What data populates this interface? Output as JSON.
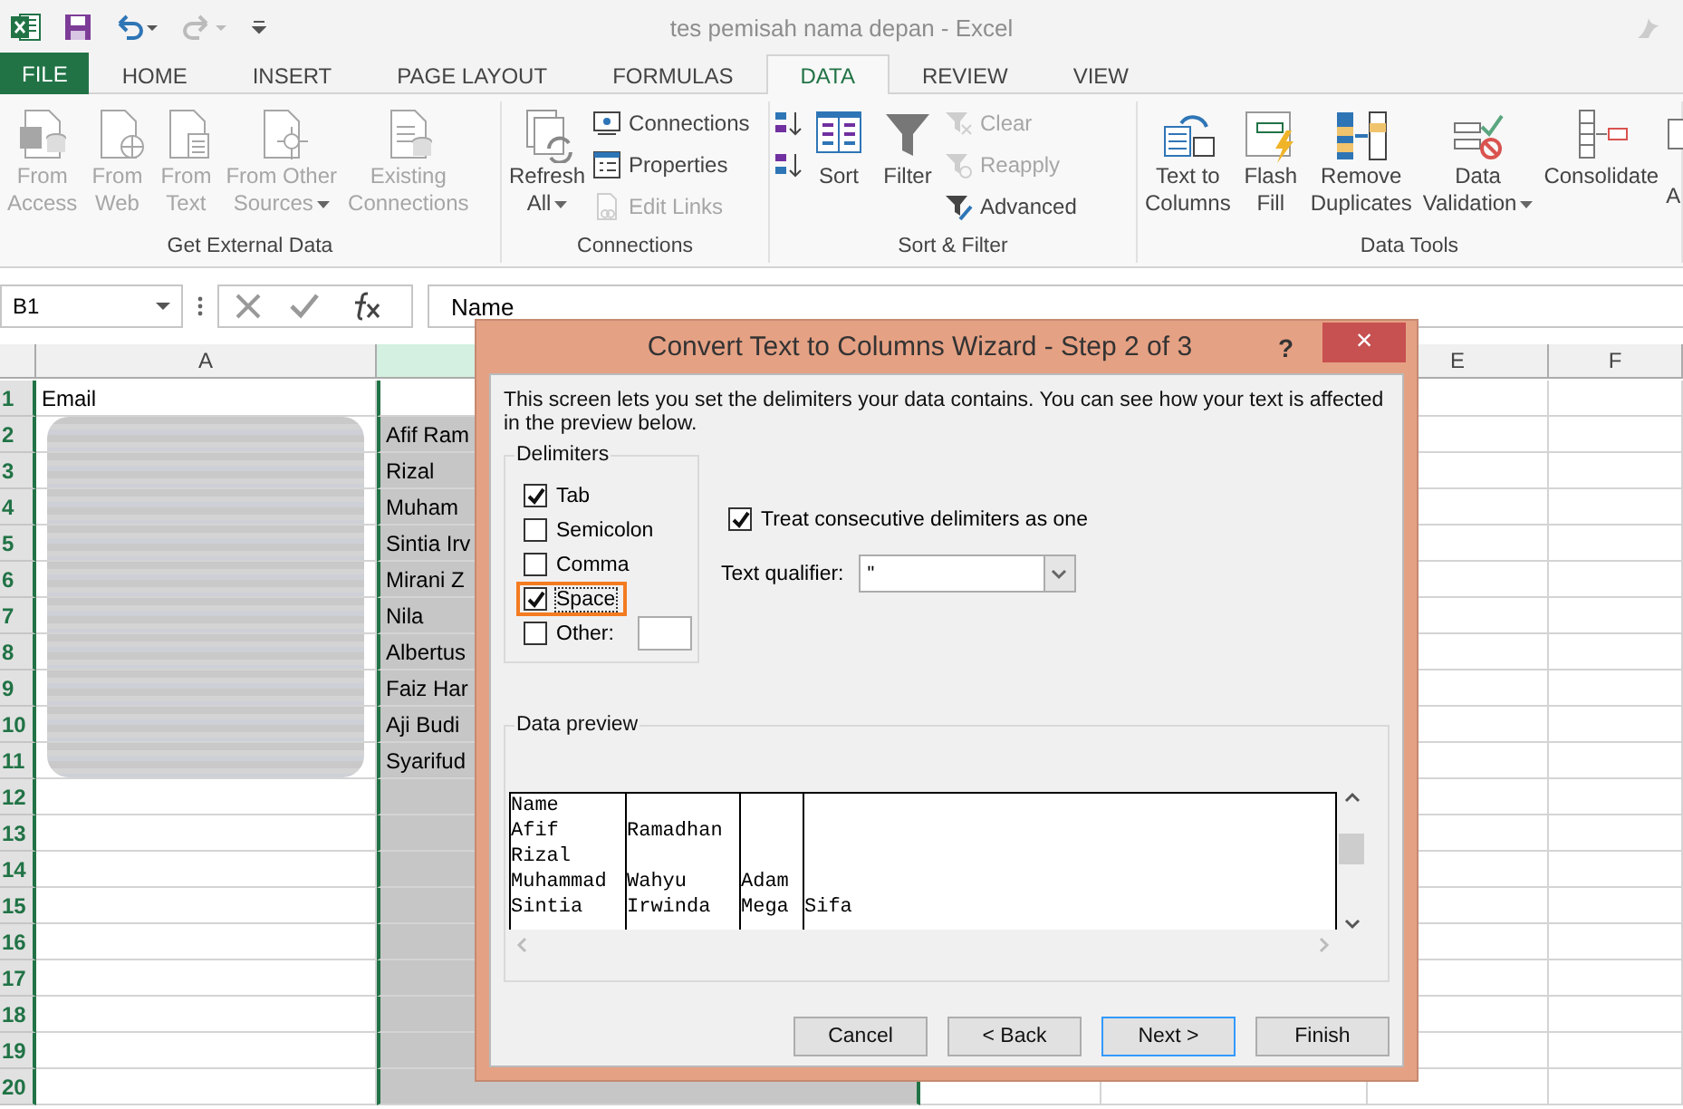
{
  "window": {
    "title": "tes pemisah nama depan - Excel"
  },
  "ribbon_tabs": [
    {
      "label": "FILE",
      "kind": "file",
      "selected": false
    },
    {
      "label": "HOME",
      "kind": "tab",
      "selected": false
    },
    {
      "label": "INSERT",
      "kind": "tab",
      "selected": false
    },
    {
      "label": "PAGE LAYOUT",
      "kind": "tab",
      "selected": false
    },
    {
      "label": "FORMULAS",
      "kind": "tab",
      "selected": false
    },
    {
      "label": "DATA",
      "kind": "tab",
      "selected": true
    },
    {
      "label": "REVIEW",
      "kind": "tab",
      "selected": false
    },
    {
      "label": "VIEW",
      "kind": "tab",
      "selected": false
    }
  ],
  "ribbon_groups": [
    {
      "label": "Get External Data",
      "items": [
        {
          "kind": "large",
          "label": "From\nAccess",
          "disabled": true
        },
        {
          "kind": "large",
          "label": "From\nWeb",
          "disabled": true
        },
        {
          "kind": "large",
          "label": "From\nText",
          "disabled": true
        },
        {
          "kind": "large",
          "label": "From Other\nSources",
          "disabled": true,
          "dropdown": true
        },
        {
          "kind": "large",
          "label": "Existing\nConnections",
          "disabled": true
        }
      ]
    },
    {
      "label": "Connections",
      "items": [
        {
          "kind": "large",
          "label": "Refresh\nAll",
          "disabled": false,
          "dropdown": true
        },
        {
          "kind": "stack",
          "items": [
            {
              "label": "Connections",
              "disabled": false
            },
            {
              "label": "Properties",
              "disabled": false
            },
            {
              "label": "Edit Links",
              "disabled": true
            }
          ]
        }
      ]
    },
    {
      "label": "Sort & Filter",
      "items": [
        {
          "kind": "stack",
          "items": [
            {
              "disabled": false
            },
            {
              "disabled": false
            }
          ]
        },
        {
          "kind": "large",
          "label": "Sort",
          "disabled": false
        },
        {
          "kind": "large",
          "label": "Filter",
          "disabled": false
        },
        {
          "kind": "stack",
          "items": [
            {
              "label": "Clear",
              "disabled": true
            },
            {
              "label": "Reapply",
              "disabled": true
            },
            {
              "label": "Advanced",
              "disabled": false
            }
          ]
        }
      ]
    },
    {
      "label": "Data Tools",
      "items": [
        {
          "kind": "large",
          "label": "Text to\nColumns",
          "disabled": false
        },
        {
          "kind": "large",
          "label": "Flash\nFill",
          "disabled": false
        },
        {
          "kind": "large",
          "label": "Remove\nDuplicates",
          "disabled": false
        },
        {
          "kind": "large",
          "label": "Data\nValidation",
          "disabled": false,
          "dropdown": true
        },
        {
          "kind": "large",
          "label": "Consolidate",
          "disabled": false
        },
        {
          "kind": "edge",
          "label": "\nA",
          "disabled": false
        }
      ]
    }
  ],
  "formula_bar": {
    "name_box": "B1",
    "value": "Name"
  },
  "sheet": {
    "columns": [
      {
        "label": "A",
        "selected": false
      },
      {
        "selected": true
      },
      {
        "label": "E",
        "selected": false
      },
      {
        "label": "F",
        "selected": false
      }
    ],
    "rows": [
      {
        "number": "1",
        "a": "Email",
        "redacted": false
      },
      {
        "number": "2",
        "b": "Afif Ram",
        "redacted": true
      },
      {
        "number": "3",
        "b": "Rizal",
        "redacted": true
      },
      {
        "number": "4",
        "b": "Muham",
        "redacted": true
      },
      {
        "number": "5",
        "b": "Sintia Irv",
        "redacted": true
      },
      {
        "number": "6",
        "b": "Mirani Z",
        "redacted": true
      },
      {
        "number": "7",
        "b": "Nila",
        "redacted": true
      },
      {
        "number": "8",
        "b": "Albertus",
        "redacted": true
      },
      {
        "number": "9",
        "b": "Faiz Har",
        "redacted": true
      },
      {
        "number": "10",
        "b": "Aji Budi",
        "redacted": true
      },
      {
        "number": "11",
        "b": "Syarifud",
        "redacted": true
      },
      {
        "number": "12",
        "redacted": false
      },
      {
        "number": "13",
        "redacted": false
      },
      {
        "number": "14",
        "redacted": false
      },
      {
        "number": "15",
        "redacted": false
      },
      {
        "number": "16",
        "redacted": false
      },
      {
        "number": "17",
        "redacted": false
      },
      {
        "number": "18",
        "redacted": false
      },
      {
        "number": "19",
        "redacted": false
      },
      {
        "number": "20",
        "redacted": false
      }
    ]
  },
  "dialog": {
    "title": "Convert Text to Columns Wizard - Step 2 of 3",
    "help": "?",
    "close": "×",
    "instructions": "This screen lets you set the delimiters your data contains.  You can see how your text is affected in the preview below.",
    "delimiters_label": "Delimiters",
    "delimiters": [
      {
        "label": "Tab",
        "checked": true,
        "highlighted": false
      },
      {
        "label": "Semicolon",
        "checked": false,
        "highlighted": false
      },
      {
        "label": "Comma",
        "checked": false,
        "highlighted": false
      },
      {
        "label": "Space",
        "checked": true,
        "highlighted": true
      },
      {
        "label": "Other:",
        "checked": false,
        "highlighted": false,
        "kind": "other"
      }
    ],
    "consecutive": {
      "label": "Treat consecutive delimiters as one",
      "checked": true
    },
    "qualifier": {
      "label": "Text qualifier:",
      "value": "\""
    },
    "preview_label": "Data preview",
    "preview_rows": [
      {
        "cells": [
          "Name"
        ]
      },
      {
        "cells": [
          "Afif",
          "Ramadhan"
        ]
      },
      {
        "cells": [
          "Rizal"
        ]
      },
      {
        "cells": [
          "Muhammad",
          "Wahyu",
          "Adam"
        ]
      },
      {
        "cells": [
          "Sintia",
          "Irwinda",
          "Mega",
          "Sifa"
        ]
      }
    ],
    "buttons": [
      {
        "label": "Cancel",
        "default": false
      },
      {
        "label": "< Back",
        "default": false
      },
      {
        "label": "Next >",
        "default": true
      },
      {
        "label": "Finish",
        "default": false
      }
    ]
  }
}
